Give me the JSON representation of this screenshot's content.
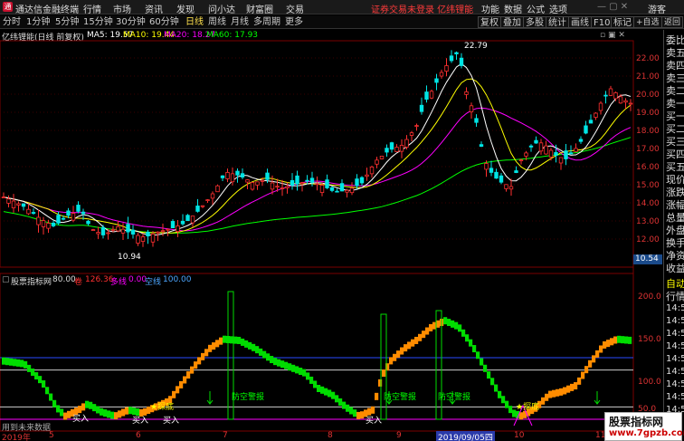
{
  "titlebar": {
    "app_title": "通达信金融终端",
    "menus": [
      "行情",
      "市场",
      "资讯",
      "发现",
      "问小达",
      "财富圈",
      "交易"
    ],
    "alert": "证券交易未登录 亿纬锂能",
    "right_menus": [
      "功能",
      "数据",
      "公式",
      "选项"
    ],
    "guest": "游客"
  },
  "toolbar": {
    "periods": [
      "分时",
      "1分钟",
      "5分钟",
      "15分钟",
      "30分钟",
      "60分钟",
      "日线",
      "周线",
      "月线",
      "多周期",
      "更多"
    ],
    "active_period": "日线",
    "right_buttons": [
      "复权",
      "叠加",
      "多股",
      "统计",
      "画线",
      "F10",
      "标记",
      "+自选",
      "返回"
    ]
  },
  "main_chart": {
    "title": "亿纬锂能(日线 前复权)",
    "ma5": "MA5: 19.57",
    "ma10": "MA10: 19.44",
    "ma20": "MA20: 18.27",
    "ma60": "MA60: 17.93",
    "high_label": "22.79",
    "low_label": "10.94",
    "current_price": "10.54",
    "y_ticks": [
      "22.00",
      "21.00",
      "20.00",
      "19.00",
      "18.00",
      "17.00",
      "16.00",
      "15.00",
      "14.00",
      "13.00",
      "12.00"
    ]
  },
  "indicator": {
    "name": "股票指标网",
    "value": "80.00",
    "red_label": "卷",
    "red_value": "126.36",
    "long_label": "多线",
    "long_value": "0.00",
    "short_label": "空线",
    "short_value": "100.00",
    "y_ticks": [
      "200.0",
      "150.0",
      "100.0",
      "50.0"
    ],
    "annotations": [
      "买入",
      "买入",
      "买入",
      "★探底",
      "防空警报",
      "防空警报",
      "防空警报",
      "买入",
      "★探底"
    ],
    "bottom_hint": "用到未来数据"
  },
  "dates": [
    "2019年",
    "5",
    "6",
    "7",
    "8",
    "9",
    "2019/09/05四",
    "10",
    "11"
  ],
  "right_panel": {
    "items": [
      "委比",
      "卖五",
      "卖四",
      "卖三",
      "卖二",
      "卖一",
      "买一",
      "买二",
      "买三",
      "买四",
      "买五",
      "现价",
      "涨跌",
      "涨幅",
      "总量",
      "外盘",
      "换手",
      "净资",
      "收益",
      "自动",
      "行情",
      "14:50",
      "14:50",
      "14:50",
      "14:50",
      "14:50",
      "14:50",
      "14:50",
      "14:50",
      "14:56"
    ]
  },
  "watermark": {
    "line1": "股票指标网",
    "line2": "www.7gpzb.com"
  },
  "colors": {
    "up": "#ff3030",
    "down": "#00e5e5",
    "ma5": "#ffffff",
    "ma10": "#ffff00",
    "ma20": "#ff00ff",
    "ma60": "#00ff00",
    "green_curve": "#00dd00",
    "orange_curve": "#ff8c00"
  }
}
